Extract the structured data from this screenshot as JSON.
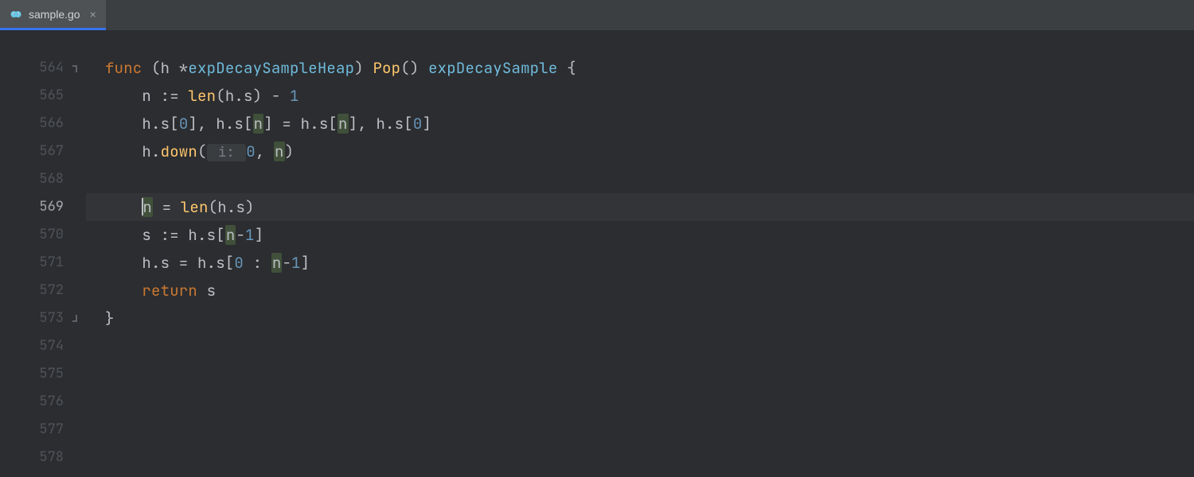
{
  "tab": {
    "filename": "sample.go",
    "close_glyph": "×"
  },
  "gutter": {
    "lines": [
      "564",
      "565",
      "566",
      "567",
      "568",
      "569",
      "570",
      "571",
      "572",
      "573",
      "574",
      "575",
      "576",
      "577",
      "578"
    ]
  },
  "code": {
    "l564": {
      "kw_func": "func",
      "recv_open": " (h *",
      "recv_type": "expDecaySampleHeap",
      "recv_close": ") ",
      "fn_name": "Pop",
      "sig_mid": "() ",
      "ret_type": "expDecaySample",
      "brace": " {"
    },
    "l565": {
      "pre": "    n := ",
      "len": "len",
      "args": "(h.s) - ",
      "one": "1"
    },
    "l566": {
      "a": "    h.s[",
      "z1": "0",
      "b": "], h.s[",
      "n1": "n",
      "c": "] = h.s[",
      "n2": "n",
      "d": "], h.s[",
      "z2": "0",
      "e": "]"
    },
    "l567": {
      "a": "    h.",
      "down": "down",
      "b": "(",
      "hint": " i: ",
      "zero": "0",
      "c": ", ",
      "n": "n",
      "d": ")"
    },
    "l569": {
      "indent": "    ",
      "n": "n",
      "eq": " = ",
      "len": "len",
      "args": "(h.s)"
    },
    "l570": {
      "a": "    s := h.s[",
      "n": "n",
      "b": "-",
      "one": "1",
      "c": "]"
    },
    "l571": {
      "a": "    h.s = h.s[",
      "z": "0",
      "b": " : ",
      "n": "n",
      "c": "-",
      "one": "1",
      "d": "]"
    },
    "l572": {
      "indent": "    ",
      "ret": "return",
      "s": " s"
    },
    "l573": {
      "brace": "}"
    }
  }
}
